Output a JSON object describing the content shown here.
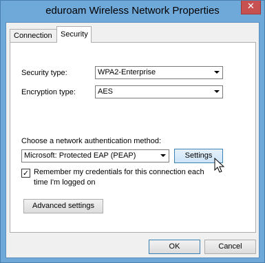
{
  "window": {
    "title": "eduroam Wireless Network Properties",
    "close_glyph": "✕"
  },
  "tabs": [
    {
      "label": "Connection",
      "active": false
    },
    {
      "label": "Security",
      "active": true
    }
  ],
  "security": {
    "security_type_label": "Security type:",
    "security_type_value": "WPA2-Enterprise",
    "encryption_type_label": "Encryption type:",
    "encryption_type_value": "AES",
    "auth_method_label": "Choose a network authentication method:",
    "auth_method_value": "Microsoft: Protected EAP (PEAP)",
    "settings_button": "Settings",
    "remember_line1": "Remember my credentials for this connection each",
    "remember_line2": "time I'm logged on",
    "remember_checked": true,
    "advanced_button": "Advanced settings"
  },
  "footer": {
    "ok_button": "OK",
    "cancel_button": "Cancel"
  }
}
